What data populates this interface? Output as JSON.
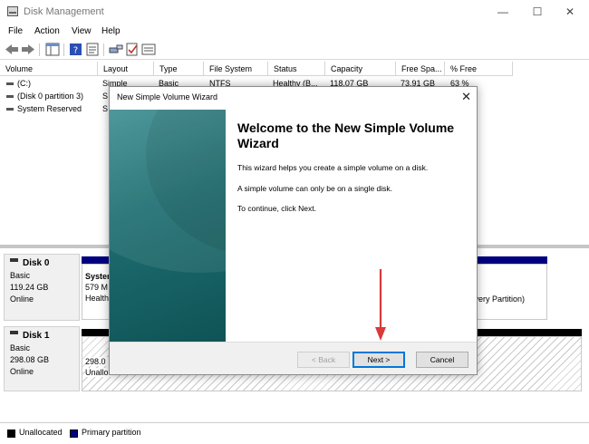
{
  "window": {
    "title": "Disk Management",
    "minimize_glyph": "—",
    "maximize_glyph": "☐",
    "close_glyph": "✕"
  },
  "menu": [
    "File",
    "Action",
    "View",
    "Help"
  ],
  "toolbar_icons": [
    "back-icon",
    "forward-icon",
    "show-hide-console-tree-icon",
    "help-icon",
    "properties-icon",
    "connect-icon",
    "check-icon",
    "list-icon"
  ],
  "volume_table": {
    "columns": [
      "Volume",
      "Layout",
      "Type",
      "File System",
      "Status",
      "Capacity",
      "Free Spa...",
      "% Free"
    ],
    "rows": [
      {
        "volume": "(C:)",
        "layout": "Simple",
        "type": "Basic",
        "fs": "NTFS",
        "status": "Healthy (B...",
        "capacity": "118.07 GB",
        "free": "73.91 GB",
        "pct": "63 %"
      },
      {
        "volume": "(Disk 0 partition 3)",
        "layout": "Si",
        "type": "",
        "fs": "",
        "status": "",
        "capacity": "",
        "free": "",
        "pct": ""
      },
      {
        "volume": "System Reserved",
        "layout": "Si",
        "type": "",
        "fs": "",
        "status": "",
        "capacity": "",
        "free": "",
        "pct": ""
      }
    ]
  },
  "disks": [
    {
      "name": "Disk 0",
      "kind": "Basic",
      "size": "119.24 GB",
      "state": "Online",
      "part_name": "Syster",
      "part_size": "579 M",
      "part_status": "Health",
      "right_text": "covery Partition)"
    },
    {
      "name": "Disk 1",
      "kind": "Basic",
      "size": "298.08 GB",
      "state": "Online",
      "part_size": "298.0",
      "part_status": "Unallo"
    }
  ],
  "legend": [
    {
      "label": "Unallocated",
      "color": "#000000"
    },
    {
      "label": "Primary partition",
      "color": "#000080"
    }
  ],
  "wizard": {
    "title": "New Simple Volume Wizard",
    "heading": "Welcome to the New Simple Volume Wizard",
    "para1": "This wizard helps you create a simple volume on a disk.",
    "para2": "A simple volume can only be on a single disk.",
    "para3": "To continue, click Next.",
    "back_label": "< Back",
    "next_label": "Next >",
    "cancel_label": "Cancel",
    "close_glyph": "✕"
  },
  "colors": {
    "primary_partition": "#000080",
    "arrow": "#d93a3a",
    "focus": "#0078d7"
  }
}
